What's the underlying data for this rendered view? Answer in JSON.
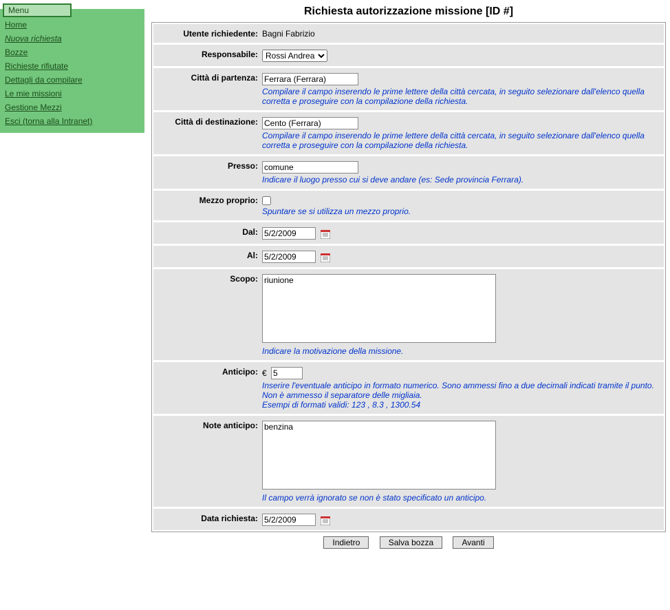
{
  "menu": {
    "title": "Menu",
    "items": [
      "Home",
      "Nuova richiesta",
      "Bozze",
      "Richieste rifiutate",
      "Dettagli da compilare",
      "Le mie missioni",
      "Gestione Mezzi",
      "Esci (torna alla Intranet)"
    ],
    "current_index": 1
  },
  "title": "Richiesta autorizzazione missione [ID #]",
  "fields": {
    "utente_label": "Utente richiedente:",
    "utente_value": "Bagni Fabrizio",
    "responsabile_label": "Responsabile:",
    "responsabile_value": "Rossi Andrea",
    "partenza_label": "Città di partenza:",
    "partenza_value": "Ferrara (Ferrara)",
    "citta_hint": "Compilare il campo inserendo le prime lettere della città cercata, in seguito selezionare dall'elenco quella corretta e proseguire con la compilazione della richiesta.",
    "destinazione_label": "Città di destinazione:",
    "destinazione_value": "Cento (Ferrara)",
    "presso_label": "Presso:",
    "presso_value": "comune",
    "presso_hint": "Indicare il luogo presso cui si deve andare (es: Sede provincia Ferrara).",
    "mezzo_label": "Mezzo proprio:",
    "mezzo_hint": "Spuntare se si utilizza un mezzo proprio.",
    "dal_label": "Dal:",
    "dal_value": "5/2/2009",
    "al_label": "Al:",
    "al_value": "5/2/2009",
    "scopo_label": "Scopo:",
    "scopo_value": "riunione",
    "scopo_hint": "Indicare la motivazione della missione.",
    "anticipo_label": "Anticipo:",
    "anticipo_currency": "€",
    "anticipo_value": "5",
    "anticipo_hint": "Inserire l'eventuale anticipo in formato numerico. Sono ammessi fino a due decimali indicati tramite il punto. Non è ammesso il separatore delle migliaia.\nEsempi di formati validi: 123 , 8.3 , 1300.54",
    "note_label": "Note anticipo:",
    "note_value": "benzina",
    "note_hint": "Il campo verrà ignorato se non è stato specificato un anticipo.",
    "data_label": "Data richiesta:",
    "data_value": "5/2/2009"
  },
  "buttons": {
    "indietro": "Indietro",
    "salva": "Salva bozza",
    "avanti": "Avanti"
  }
}
